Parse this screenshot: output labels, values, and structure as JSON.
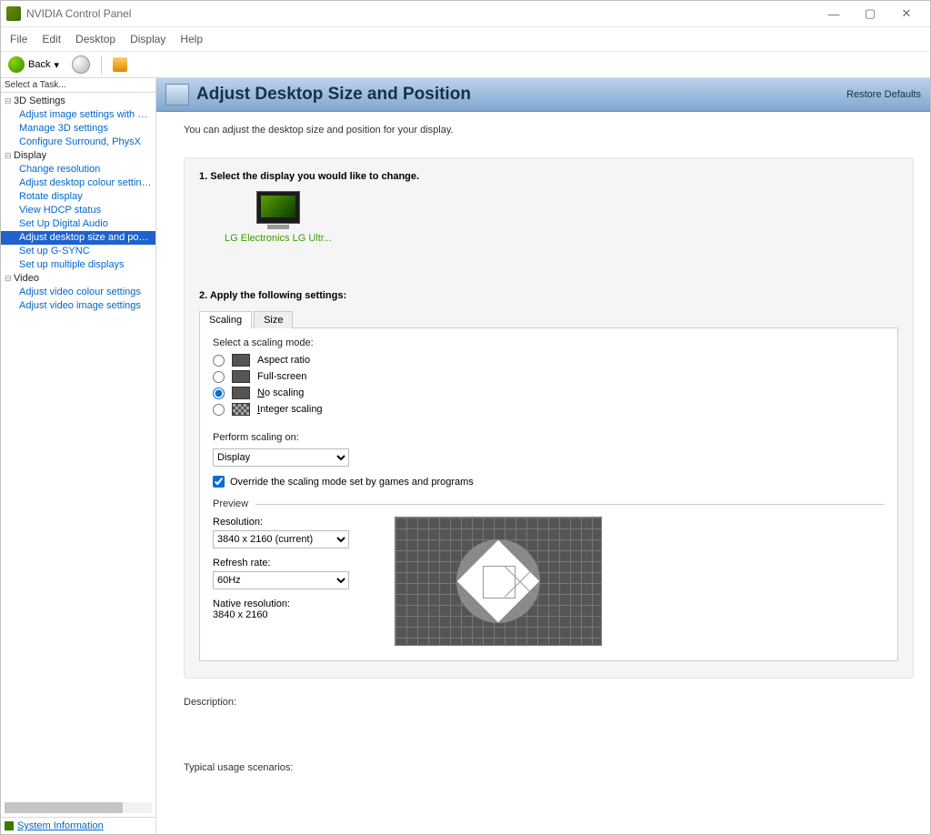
{
  "title": "NVIDIA Control Panel",
  "menus": {
    "file": "File",
    "edit": "Edit",
    "desktop": "Desktop",
    "display": "Display",
    "help": "Help"
  },
  "toolbar": {
    "back": "Back"
  },
  "sidebar": {
    "header": "Select a Task...",
    "cat1": "3D Settings",
    "cat1_items": [
      "Adjust image settings with preview",
      "Manage 3D settings",
      "Configure Surround, PhysX"
    ],
    "cat2": "Display",
    "cat2_items": [
      "Change resolution",
      "Adjust desktop colour settings",
      "Rotate display",
      "View HDCP status",
      "Set Up Digital Audio",
      "Adjust desktop size and position",
      "Set up G-SYNC",
      "Set up multiple displays"
    ],
    "cat3": "Video",
    "cat3_items": [
      "Adjust video colour settings",
      "Adjust video image settings"
    ],
    "sysinfo": "System Information"
  },
  "page": {
    "title": "Adjust Desktop Size and Position",
    "restore": "Restore Defaults",
    "intro": "You can adjust the desktop size and position for your display.",
    "step1": "1. Select the display you would like to change.",
    "monitor_label": "LG Electronics LG Ultr...",
    "step2": "2. Apply the following settings:",
    "tabs": {
      "scaling": "Scaling",
      "size": "Size"
    },
    "scaling": {
      "select_mode": "Select a scaling mode:",
      "aspect": "Aspect ratio",
      "full": "Full-screen",
      "none": "No scaling",
      "none_u": "N",
      "integer": "Integer scaling",
      "integer_u": "I",
      "perform": "Perform scaling on:",
      "perform_value": "Display",
      "override": "Override the scaling mode set by games and programs",
      "preview": "Preview",
      "resolution_lbl": "Resolution:",
      "resolution": "3840 x 2160 (current)",
      "refresh_lbl": "Refresh rate:",
      "refresh": "60Hz",
      "native_lbl": "Native resolution:",
      "native": "3840 x 2160"
    },
    "description_lbl": "Description:",
    "usage_lbl": "Typical usage scenarios:"
  }
}
